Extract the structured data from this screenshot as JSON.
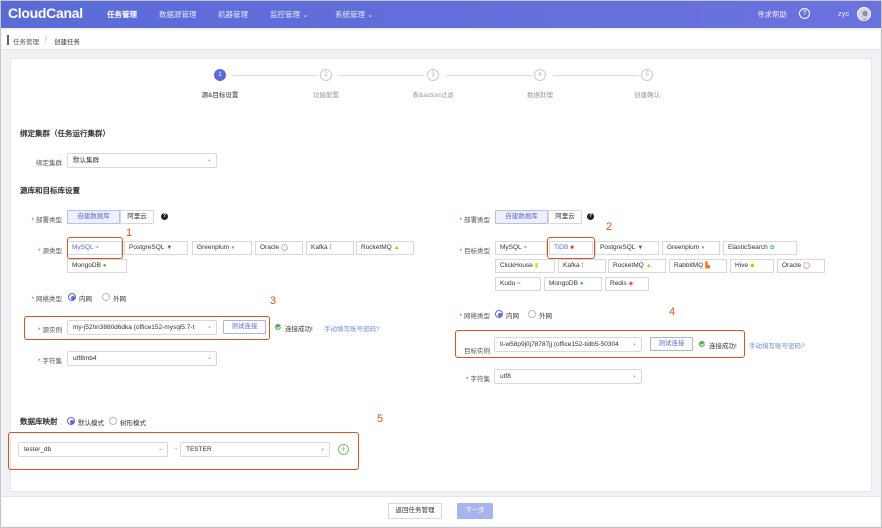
{
  "brand": {
    "name": "CloudCanal"
  },
  "nav": {
    "items": [
      {
        "label": "任务管理"
      },
      {
        "label": "数据源管理"
      },
      {
        "label": "机器管理"
      },
      {
        "label": "监控管理 ⌄"
      },
      {
        "label": "系统管理 ⌄"
      }
    ],
    "help_label": "寻求帮助",
    "help_icon": "?",
    "user": "zyc"
  },
  "breadcrumb": {
    "parent": "任务管理",
    "sep": "/",
    "current": "创建任务"
  },
  "steps": [
    {
      "num": "1",
      "label": "源&目标设置"
    },
    {
      "num": "2",
      "label": "功能配置"
    },
    {
      "num": "3",
      "label": "表&action过滤"
    },
    {
      "num": "4",
      "label": "数据处理"
    },
    {
      "num": "5",
      "label": "创建确认"
    }
  ],
  "cluster": {
    "title": "绑定集群（任务运行集群）",
    "label": "绑定集群",
    "value": "默认集群"
  },
  "db_section": {
    "title": "源库和目标库设置"
  },
  "source": {
    "deploy_label": "部署类型",
    "deploy_options": [
      "自建数据库",
      "阿里云"
    ],
    "help": "?",
    "type_label": "源类型",
    "types": [
      {
        "name": "MySQL",
        "glyph": "≈"
      },
      {
        "name": "PostgreSQL",
        "glyph": "▼"
      },
      {
        "name": "Greenplum",
        "glyph": "●"
      },
      {
        "name": "Oracle",
        "glyph": "◯"
      },
      {
        "name": "Kafka",
        "glyph": "⁞"
      },
      {
        "name": "RocketMQ",
        "glyph": "▲"
      },
      {
        "name": "MongoDB",
        "glyph": "●"
      }
    ],
    "network_label": "网络类型",
    "network_options": [
      "内网",
      "外网"
    ],
    "instance_label": "源实例",
    "instance_value": "my-j52hri3880d6dka (office152-mysql5.7-t",
    "test_btn": "测试连接",
    "status": "连接成功!",
    "manual_link": "手动填写账号密码?",
    "charset_label": "字符集",
    "charset_value": "utf8mb4"
  },
  "target": {
    "deploy_label": "部署类型",
    "deploy_options": [
      "自建数据库",
      "阿里云"
    ],
    "help": "?",
    "type_label": "目标类型",
    "types": [
      {
        "name": "MySQL",
        "glyph": "≈"
      },
      {
        "name": "TiDB",
        "glyph": "■"
      },
      {
        "name": "PostgreSQL",
        "glyph": "▼"
      },
      {
        "name": "Greenplum",
        "glyph": "●"
      },
      {
        "name": "ElasticSearch",
        "glyph": "✿"
      },
      {
        "name": "ClickHouse",
        "glyph": "▮"
      },
      {
        "name": "Kafka",
        "glyph": "⁞"
      },
      {
        "name": "RocketMQ",
        "glyph": "▲"
      },
      {
        "name": "RabbitMQ",
        "glyph": "▙"
      },
      {
        "name": "Hive",
        "glyph": "◆"
      },
      {
        "name": "Oracle",
        "glyph": "◯"
      },
      {
        "name": "Kudu",
        "glyph": "≈"
      },
      {
        "name": "MongoDB",
        "glyph": "●"
      },
      {
        "name": "Redis",
        "glyph": "◈"
      }
    ],
    "network_label": "网络类型",
    "network_options": [
      "内网",
      "外网"
    ],
    "instance_label": "目标实例",
    "instance_value": "ti-w58p9j0j78787jj (office152-tidb5-50304",
    "test_btn": "测试连接",
    "status": "连接成功!",
    "manual_link": "手动填写账号密码?",
    "charset_label": "字符集",
    "charset_value": "utf8"
  },
  "mapping": {
    "title": "数据库映射",
    "modes": [
      "默认模式",
      "树形模式"
    ],
    "source_db": "tester_db",
    "arrow": "→",
    "target_db": "TESTER"
  },
  "annotations": [
    "1",
    "2",
    "3",
    "4",
    "5"
  ],
  "footer": {
    "back": "返回任务管理",
    "next": "下一步"
  },
  "colors": {
    "nav": "#5a6bd8",
    "accent": "#5c6ad6",
    "annotation": "#d9541e",
    "success": "#4caf50"
  }
}
